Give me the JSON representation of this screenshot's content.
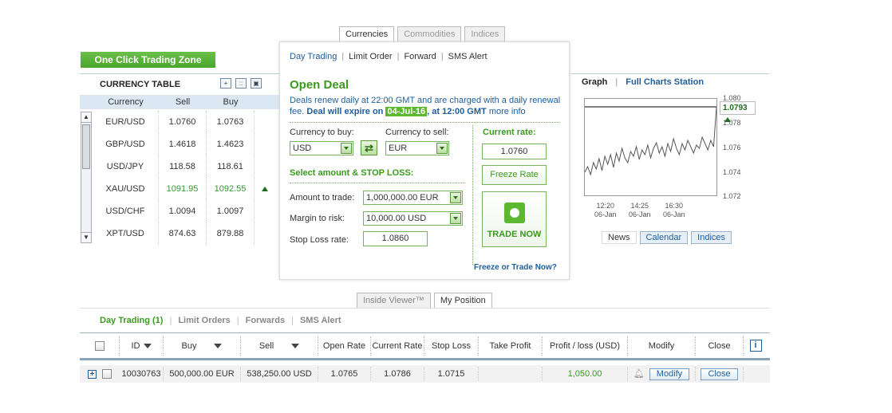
{
  "left_panel": {
    "one_click_label": "One Click Trading Zone",
    "currency_table_title": "CURRENCY TABLE",
    "view_icons": [
      "plus-icon",
      "grid-icon",
      "detail-icon"
    ],
    "columns": [
      "Currency",
      "Sell",
      "Buy"
    ],
    "rows": [
      {
        "currency": "EUR/USD",
        "sell": "1.0760",
        "buy": "1.0763",
        "trend": ""
      },
      {
        "currency": "GBP/USD",
        "sell": "1.4618",
        "buy": "1.4623",
        "trend": ""
      },
      {
        "currency": "USD/JPY",
        "sell": "118.58",
        "buy": "118.61",
        "trend": ""
      },
      {
        "currency": "XAU/USD",
        "sell": "1091.95",
        "buy": "1092.55",
        "trend": "up"
      },
      {
        "currency": "USD/CHF",
        "sell": "1.0094",
        "buy": "1.0097",
        "trend": ""
      },
      {
        "currency": "XPT/USD",
        "sell": "874.63",
        "buy": "879.88",
        "trend": ""
      }
    ]
  },
  "center": {
    "tabs": [
      {
        "label": "Currencies",
        "active": true
      },
      {
        "label": "Commodities",
        "active": false
      },
      {
        "label": "Indices",
        "active": false
      }
    ],
    "subnav": [
      {
        "label": "Day Trading",
        "active": true
      },
      {
        "label": "Limit Order",
        "active": false
      },
      {
        "label": "Forward",
        "active": false
      },
      {
        "label": "SMS Alert",
        "active": false
      }
    ],
    "title": "Open Deal",
    "renew_text_1": "Deals renew daily at 22:00 GMT and are charged with a",
    "renew_link": "daily renewal fee.",
    "expire_prefix": "Deal will expire on",
    "expire_date": "04-Jul-16",
    "expire_suffix": ", at 12:00 GMT",
    "more_info": "more info",
    "currency_to_buy_label": "Currency to buy:",
    "currency_to_buy": "USD",
    "currency_to_sell_label": "Currency to sell:",
    "currency_to_sell": "EUR",
    "amount_section_title": "Select amount & STOP LOSS:",
    "amount_label": "Amount to trade:",
    "amount_value": "1,000,000.00 EUR",
    "margin_label": "Margin to risk:",
    "margin_value": "10,000.00 USD",
    "stop_loss_label": "Stop Loss rate:",
    "stop_loss_value": "1.0860",
    "current_rate_label": "Current rate:",
    "current_rate_value": "1.0760",
    "freeze_rate_label": "Freeze Rate",
    "trade_now_label": "TRADE NOW",
    "freeze_or_trade_link": "Freeze or Trade Now?"
  },
  "graph": {
    "title": "Graph",
    "full_charts_link": "Full Charts Station",
    "current_value": "1.0793",
    "y_ticks": [
      "1.080",
      "1.078",
      "1.076",
      "1.074",
      "1.072"
    ],
    "x_ticks": [
      {
        "time": "12:20",
        "date": "06-Jan"
      },
      {
        "time": "14:25",
        "date": "06-Jan"
      },
      {
        "time": "16:30",
        "date": "06-Jan"
      }
    ],
    "tabs": [
      {
        "label": "News",
        "active": true
      },
      {
        "label": "Calendar",
        "active": false
      },
      {
        "label": "Indices",
        "active": false
      }
    ],
    "colors": {
      "line": "#555555",
      "up": "#1a6e1a"
    }
  },
  "bottom": {
    "tabs": [
      {
        "label": "Inside Viewer™",
        "active": false
      },
      {
        "label": "My Position",
        "active": true
      }
    ],
    "nav": [
      {
        "label": "Day Trading (1)",
        "active": true
      },
      {
        "label": "Limit Orders",
        "active": false
      },
      {
        "label": "Forwards",
        "active": false
      },
      {
        "label": "SMS Alert",
        "active": false
      }
    ],
    "columns": [
      "ID",
      "Buy",
      "Sell",
      "Open Rate",
      "Current Rate",
      "Stop Loss",
      "Take Profit",
      "Profit / loss (USD)",
      "Modify",
      "Close"
    ],
    "rows": [
      {
        "id": "10030763",
        "buy": "500,000.00 EUR",
        "sell": "538,250.00 USD",
        "open_rate": "1.0765",
        "current_rate": "1.0786",
        "stop_loss": "1.0715",
        "take_profit": "",
        "profit_loss": "1,050.00",
        "modify": "Modify",
        "close": "Close"
      }
    ]
  }
}
